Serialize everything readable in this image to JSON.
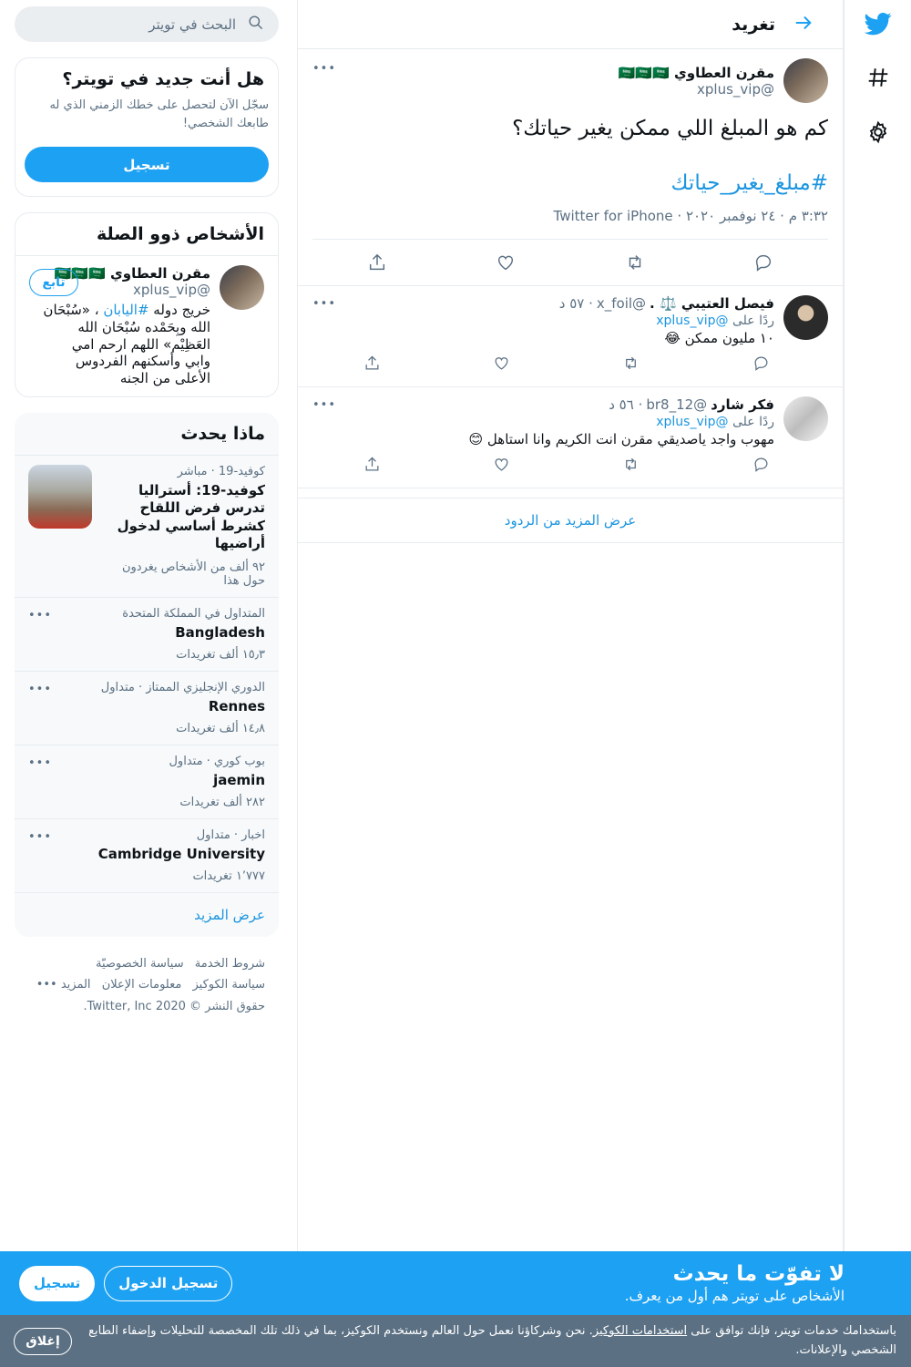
{
  "nav": {
    "logo_icon": "twitter-bird-icon",
    "explore_icon": "hashtag-icon",
    "settings_icon": "gear-icon"
  },
  "header": {
    "title": "تغريد",
    "back_icon": "back-arrow-icon"
  },
  "main_tweet": {
    "name": "مقرن العطاوي 🇸🇦🇸🇦🇸🇦",
    "handle": "@xplus_vip",
    "text": "كم هو المبلغ اللي ممكن يغير حياتك؟",
    "hashtag": "#مبلغ_يغير_حياتك",
    "meta": "٣:٣٢ م · ٢٤ نوفمبر ٢٠٢٠ · Twitter for iPhone"
  },
  "replies": [
    {
      "name": "فيصل العتيبي ⚖️ .",
      "handle": "@x_foil",
      "time": "· ٥٧ د",
      "replying_prefix": "ردًا على",
      "replying_to": "@xplus_vip",
      "text": "١٠ مليون ممكن 😂"
    },
    {
      "name": "فكر شارد",
      "handle": "@br8_12",
      "time": "· ٥٦ د",
      "replying_prefix": "ردًا على",
      "replying_to": "@xplus_vip",
      "text": "مهوب واجد ياصديقي مقرن انت الكريم وانا استاهل 😊"
    }
  ],
  "more_replies": "عرض المزيد من الردود",
  "sidebar": {
    "search_placeholder": "البحث في تويتر",
    "new_title": "هل أنت جديد في تويتر؟",
    "new_text": "سجّل الآن لتحصل على خطك الزمني الذي له طابعك الشخصي!",
    "signup": "تسجيل",
    "relevant_title": "الأشخاص ذوو الصلة",
    "person": {
      "name": "مقرن العطاوي 🇸🇦🇸🇦🇸🇦",
      "handle": "@xplus_vip",
      "follow": "تابع",
      "bio_before": "خريج دوله ",
      "bio_tag": "#اليابان",
      "bio_after": " ، «سُبْحَان الله وبِحَمْده سُبْحَان الله العَظِيْم» اللهم ارحم امي وابي وأسكنهم الفردوس الأعلى من الجنه"
    },
    "whats_happening": "ماذا يحدث",
    "news": {
      "context": "كوفيد-19 · مباشر",
      "headline": "كوفيد-19: أستراليا تدرس فرض اللقاح كشرط أساسي لدخول أراضيها",
      "count": "٩٢ ألف من الأشخاص يغردون حول هذا"
    },
    "trends": [
      {
        "context": "المتداول في المملكة المتحدة",
        "topic": "Bangladesh",
        "count": "١٥٫٣ ألف تغريدات"
      },
      {
        "context": "الدوري الإنجليزي الممتاز · متداول",
        "topic": "Rennes",
        "count": "١٤٫٨ ألف تغريدات"
      },
      {
        "context": "بوب كوري · متداول",
        "topic": "jaemin",
        "count": "٢٨٢ ألف تغريدات"
      },
      {
        "context": "اخبار · متداول",
        "topic": "Cambridge University",
        "count": "١٬٧٧٧ تغريدات"
      }
    ],
    "show_more": "عرض المزيد",
    "footer": {
      "terms": "شروط الخدمة",
      "privacy": "سياسة الخصوصيّة",
      "cookies": "سياسة الكوكيز",
      "ads": "معلومات الإعلان",
      "more": "المزيد •••",
      "copyright": "حقوق النشر © 2020 Twitter, Inc."
    }
  },
  "bottom_bar": {
    "title": "لا تفوّت ما يحدث",
    "subtitle": "الأشخاص على تويتر هم أول من يعرف.",
    "login": "تسجيل الدخول",
    "signup": "تسجيل"
  },
  "cookie_bar": {
    "before": "باستخدامك خدمات تويتر، فإنك توافق على ",
    "link": "استخدامات الكوكيز",
    "after": ". نحن وشركاؤنا نعمل حول العالم ونستخدم الكوكيز، بما في ذلك تلك المخصصة للتحليلات وإضفاء الطابع الشخصي والإعلانات.",
    "close": "إغلاق"
  },
  "colors": {
    "accent": "#1da1f2",
    "link": "#1b95e0",
    "secondary_text": "#5b7083"
  }
}
